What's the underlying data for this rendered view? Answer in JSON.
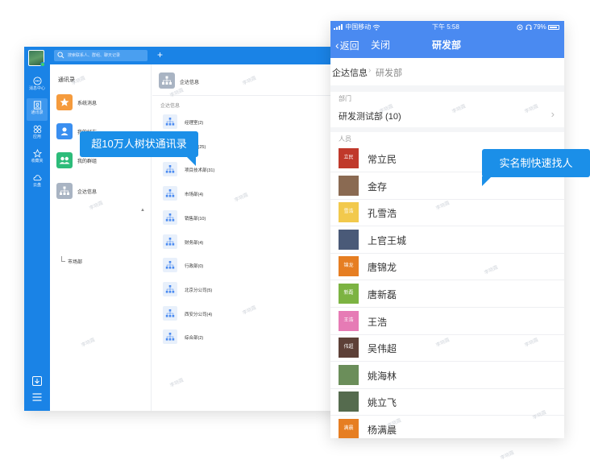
{
  "desktop": {
    "search_placeholder": "搜索联系人、群组、聊天记录",
    "add_label": "+",
    "rail": [
      {
        "label": "消息中心",
        "icon": "message-icon"
      },
      {
        "label": "通讯录",
        "icon": "contacts-icon"
      },
      {
        "label": "应用",
        "icon": "apps-icon"
      },
      {
        "label": "收藏夹",
        "icon": "star-icon"
      },
      {
        "label": "云盘",
        "icon": "cloud-icon"
      }
    ],
    "contacts_title": "通讯录",
    "entries": [
      {
        "label": "系统消息",
        "color": "#f59b3d",
        "icon": "star-badge-icon"
      },
      {
        "label": "我的好友",
        "color": "#3a8ff0",
        "icon": "user-icon"
      },
      {
        "label": "我的群组",
        "color": "#2dbc7a",
        "icon": "group-icon"
      },
      {
        "label": "企达信息",
        "color": "#a9b4c3",
        "icon": "org-icon"
      }
    ],
    "sub_item": "市场部",
    "col2_title": "企达信息",
    "col2_section": "企达信息",
    "departments": [
      "经理室(2)",
      "市场部(25)",
      "项目技术部(31)",
      "市场部(4)",
      "销售部(10)",
      "财务部(4)",
      "行政部(0)",
      "北京分公司(5)",
      "西安分公司(4)",
      "综合部(2)"
    ]
  },
  "phone": {
    "carrier": "中国移动",
    "time": "下午 5:58",
    "battery": "79%",
    "back_label": "返回",
    "close_label": "关闭",
    "title": "研发部",
    "breadcrumb": [
      "企达信息",
      "研发部"
    ],
    "dept_header": "部门",
    "dept_value": "研发测试部 (10)",
    "people_header": "人员",
    "people": [
      {
        "name": "常立民",
        "avatar_text": "立民",
        "color": "#c0392b"
      },
      {
        "name": "金存",
        "avatar_text": "",
        "color": "#8a6a52"
      },
      {
        "name": "孔雪浩",
        "avatar_text": "雪浩",
        "color": "#f2c94c"
      },
      {
        "name": "上官王城",
        "avatar_text": "",
        "color": "#4a5a78"
      },
      {
        "name": "唐锦龙",
        "avatar_text": "锦龙",
        "color": "#e67e22"
      },
      {
        "name": "唐新磊",
        "avatar_text": "新磊",
        "color": "#7cb342"
      },
      {
        "name": "王浩",
        "avatar_text": "王浩",
        "color": "#e67bb5"
      },
      {
        "name": "吴伟超",
        "avatar_text": "伟超",
        "color": "#5d4037"
      },
      {
        "name": "姚海林",
        "avatar_text": "",
        "color": "#6b8e5a"
      },
      {
        "name": "姚立飞",
        "avatar_text": "",
        "color": "#556b4e"
      },
      {
        "name": "杨满晨",
        "avatar_text": "满晨",
        "color": "#e67e22"
      }
    ]
  },
  "callouts": {
    "left": "超10万人树状通讯录",
    "right": "实名制快速找人"
  },
  "watermark": "李晓霞"
}
